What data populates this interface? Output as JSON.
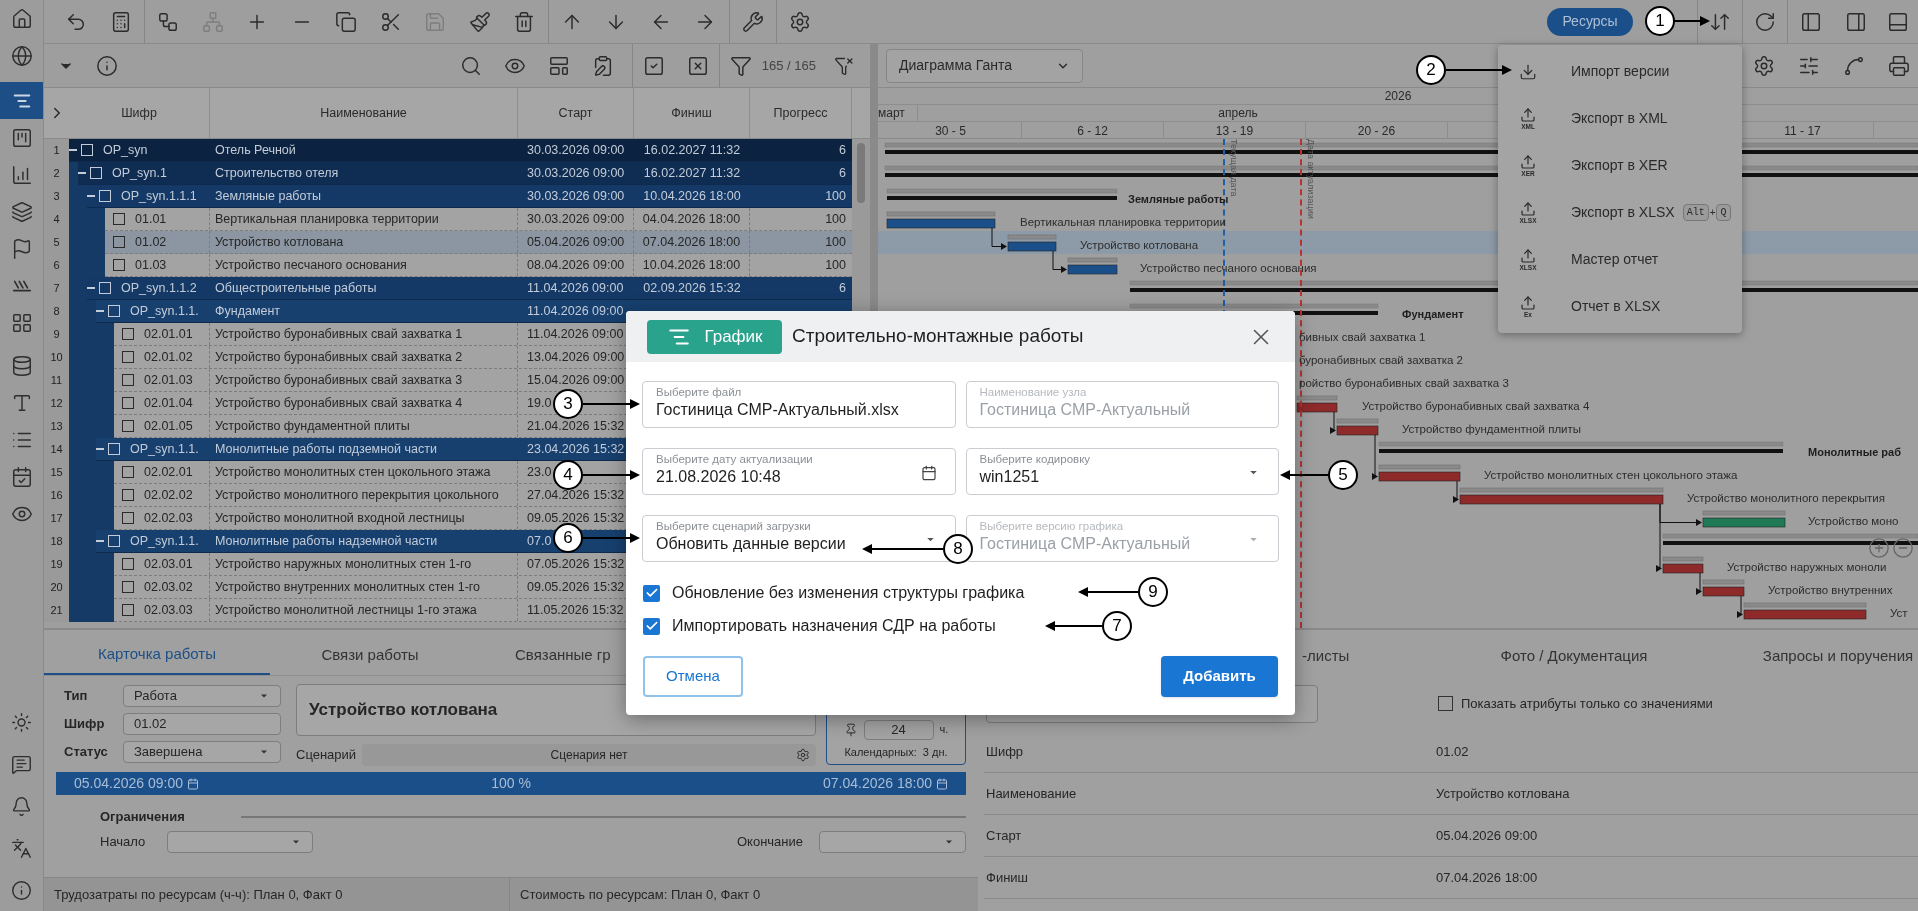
{
  "sidebar": {
    "items": [
      {
        "selected": false
      },
      {
        "selected": false
      },
      {
        "selected": true
      },
      {
        "selected": false
      },
      {
        "selected": false
      },
      {
        "selected": false
      },
      {
        "selected": false
      },
      {
        "selected": false
      },
      {
        "selected": false
      },
      {
        "selected": false
      },
      {
        "selected": false
      },
      {
        "selected": false
      },
      {
        "selected": false
      },
      {
        "selected": false
      }
    ]
  },
  "toolbar": {
    "tools": [
      {
        "disabled": false
      },
      {
        "disabled": false
      },
      {
        "disabled": false
      },
      {
        "disabled": true
      },
      {
        "disabled": false
      },
      {
        "disabled": false
      },
      {
        "disabled": false
      },
      {
        "disabled": false
      },
      {
        "disabled": true
      },
      {
        "disabled": false
      },
      {
        "disabled": false
      },
      {
        "disabled": false
      },
      {
        "disabled": false
      },
      {
        "disabled": false
      },
      {
        "disabled": false
      },
      {
        "disabled": false
      },
      {
        "disabled": false
      }
    ],
    "resources_button": "Ресурсы"
  },
  "filter_count": "165 / 165",
  "table": {
    "columns": [
      "Шифр",
      "Наименование",
      "Старт",
      "Финиш",
      "Прогресс"
    ],
    "rows": [
      {
        "num": "1",
        "code": "OP_syn",
        "name": "Отель Речной",
        "start": "30.03.2026 09:00",
        "finish": "16.02.2027 11:32",
        "progress": "6",
        "expanded": true,
        "checked": false,
        "selected": false,
        "children": [
          {
            "num": "2",
            "code": "OP_syn.1",
            "name": "Строительство отеля",
            "start": "30.03.2026 09:00",
            "finish": "16.02.2027 11:32",
            "progress": "6",
            "expanded": true,
            "checked": false,
            "selected": false,
            "children": [
              {
                "num": "3",
                "code": "OP_syn.1.1.1",
                "name": "Земляные работы",
                "start": "30.03.2026 09:00",
                "finish": "10.04.2026 18:00",
                "progress": "100",
                "expanded": true,
                "checked": false,
                "selected": false,
                "children": [
                  {
                    "num": "4",
                    "code": "01.01",
                    "name": "Вертикальная планировка территории",
                    "start": "30.03.2026 09:00",
                    "finish": "04.04.2026 18:00",
                    "progress": "100",
                    "checked": false,
                    "selected": false
                  },
                  {
                    "num": "5",
                    "code": "01.02",
                    "name": "Устройство котлована",
                    "start": "05.04.2026 09:00",
                    "finish": "07.04.2026 18:00",
                    "progress": "100",
                    "checked": false,
                    "selected": true
                  },
                  {
                    "num": "6",
                    "code": "01.03",
                    "name": "Устройство песчаного основания",
                    "start": "08.04.2026 09:00",
                    "finish": "10.04.2026 18:00",
                    "progress": "100",
                    "checked": false,
                    "selected": false
                  }
                ]
              },
              {
                "num": "7",
                "code": "OP_syn.1.1.2",
                "name": "Общестроительные работы",
                "start": "11.04.2026 09:00",
                "finish": "02.09.2026 15:32",
                "progress": "6",
                "expanded": true,
                "checked": false,
                "selected": false,
                "children": [
                  {
                    "num": "8",
                    "code": "OP_syn.1.1.",
                    "name": "Фундамент",
                    "start": "11.04.2026 09:00",
                    "expanded": true,
                    "checked": false,
                    "selected": false,
                    "children": [
                      {
                        "num": "9",
                        "code": "02.01.01",
                        "name": "Устройство буронабивных свай захватка 1",
                        "start": "11.04.2026 09:00",
                        "checked": false,
                        "selected": false
                      },
                      {
                        "num": "10",
                        "code": "02.01.02",
                        "name": "Устройство буронабивных свай захватка 2",
                        "start": "13.04.2026 09:00",
                        "checked": false,
                        "selected": false
                      },
                      {
                        "num": "11",
                        "code": "02.01.03",
                        "name": "Устройство буронабивных свай захватка 3",
                        "start": "15.04.2026 09:00",
                        "checked": false,
                        "selected": false
                      },
                      {
                        "num": "12",
                        "code": "02.01.04",
                        "name": "Устройство буронабивных свай захватка 4",
                        "start": "19.0",
                        "checked": false,
                        "selected": false
                      },
                      {
                        "num": "13",
                        "code": "02.01.05",
                        "name": "Устройство фундаментной плиты",
                        "start": "21.04.2026 15:32",
                        "checked": false,
                        "selected": false
                      }
                    ]
                  },
                  {
                    "num": "14",
                    "code": "OP_syn.1.1.",
                    "name": "Монолитные работы подземной части",
                    "start": "23.04.2026 15:32",
                    "expanded": true,
                    "checked": false,
                    "selected": false,
                    "children": [
                      {
                        "num": "15",
                        "code": "02.02.01",
                        "name": "Устройство монолитных стен цокольного этажа",
                        "start": "23.0",
                        "checked": false,
                        "selected": false
                      },
                      {
                        "num": "16",
                        "code": "02.02.02",
                        "name": "Устройство монолитного перекрытия цокольного",
                        "start": "27.04.2026 15:32",
                        "checked": false,
                        "selected": false
                      },
                      {
                        "num": "17",
                        "code": "02.02.03",
                        "name": "Устройство монолитной входной лестницы",
                        "start": "09.05.2026 15:32",
                        "checked": false,
                        "selected": false
                      }
                    ]
                  },
                  {
                    "num": "18",
                    "code": "OP_syn.1.1.",
                    "name": "Монолитные работы надземной части",
                    "start": "07.0",
                    "expanded": true,
                    "checked": false,
                    "selected": false,
                    "children": [
                      {
                        "num": "19",
                        "code": "02.03.01",
                        "name": "Устройство наружных монолитных стен 1-го",
                        "start": "07.05.2026 15:32",
                        "checked": false,
                        "selected": false
                      },
                      {
                        "num": "20",
                        "code": "02.03.02",
                        "name": "Устройство внутренних монолитных стен 1-го",
                        "start": "09.05.2026 15:32",
                        "checked": false,
                        "selected": false
                      },
                      {
                        "num": "21",
                        "code": "02.03.03",
                        "name": "Устройство монолитной лестницы 1-го этажа",
                        "start": "11.05.2026 15:32",
                        "checked": false,
                        "selected": false
                      }
                    ]
                  }
                ]
              }
            ]
          }
        ]
      }
    ]
  },
  "gantt": {
    "view": "Диаграмма Ганта",
    "year": "2026",
    "months": [
      "март",
      "апрель"
    ],
    "weeks": [
      "30 - 5",
      "6 - 12",
      "13 - 19",
      "20 - 26",
      "11 - 17"
    ],
    "markers": [
      {
        "label": "Текущая дата",
        "color": "#1f5fa8"
      },
      {
        "label": "Дата актуализации",
        "color": "#b83232"
      }
    ],
    "tasks": [
      {
        "kind": "summary"
      },
      {
        "kind": "summary"
      },
      {
        "kind": "summary",
        "label": "Земляные работы"
      },
      {
        "kind": "task",
        "color": "#1b4f8a",
        "label": "Вертикальная планировка территории"
      },
      {
        "kind": "task",
        "color": "#1b4f8a",
        "label": "Устройство котлована"
      },
      {
        "kind": "task",
        "color": "#1b4f8a",
        "label": "Устройство песчаного основания"
      },
      {
        "kind": "summary"
      },
      {
        "kind": "summary",
        "label": "Фундамент"
      },
      {
        "kind": "task",
        "label": "бивных свай захватка 1"
      },
      {
        "kind": "task",
        "label": "буронабивных свай захватка 2"
      },
      {
        "kind": "task",
        "label": "ройство буронабивных свай захватка 3"
      },
      {
        "kind": "task",
        "color": "#8f2a2a",
        "label": "Устройство буронабивных свай захватка 4"
      },
      {
        "kind": "task",
        "color": "#8f2a2a",
        "label": "Устройство фундаментной плиты"
      },
      {
        "kind": "summary",
        "label": "Монолитные раб"
      },
      {
        "kind": "task",
        "color": "#8f2a2a",
        "label": "Устройство монолитных стен цокольного этажа"
      },
      {
        "kind": "task",
        "color": "#8f2a2a",
        "label": "Устройство монолитного перекрытия"
      },
      {
        "kind": "task",
        "color": "#1f7a55",
        "label": "Устройство моно"
      },
      {
        "kind": "summary"
      },
      {
        "kind": "task",
        "color": "#8f2a2a",
        "label": "Устройство наружных моноли"
      },
      {
        "kind": "task",
        "color": "#8f2a2a",
        "label": "Устройство внутренних"
      },
      {
        "kind": "task",
        "color": "#8f2a2a",
        "label": "Уст"
      }
    ]
  },
  "menu": {
    "items": [
      {
        "label": "Импорт версии"
      },
      {
        "label": "Экспорт в XML",
        "badge": "XML"
      },
      {
        "label": "Экспорт в XER",
        "badge": "XER"
      },
      {
        "label": "Экспорт в XLSX",
        "badge": "XLSX",
        "shortcut": [
          "Alt",
          "+",
          "Q"
        ]
      },
      {
        "label": "Мастер отчет",
        "badge": "XLSX"
      },
      {
        "label": "Отчет в XLSX",
        "badge": "Ex"
      }
    ]
  },
  "card": {
    "tabs": [
      {
        "label": "Карточка работы",
        "selected": true
      },
      {
        "label": "Связи работы",
        "selected": false
      },
      {
        "label": "Связанные гр",
        "selected": false
      }
    ],
    "type_label": "Тип",
    "type_value": "Работа",
    "code_label": "Шифр",
    "code_value": "01.02",
    "status_label": "Статус",
    "status_value": "Завершена",
    "title": "Устройство котлована",
    "scenario_label": "Сценарий",
    "scenario_value": "Сценария нет",
    "hours": "24",
    "hours_unit": "ч.",
    "calendar_days": "Календарных:  3 дн.",
    "start": "05.04.2026 09:00",
    "progress_text": "100 %",
    "progress": {
      "level": 1
    },
    "finish": "07.04.2026 18:00",
    "constraints_title": "Ограничения",
    "begin_label": "Начало",
    "end_label": "Окончание",
    "footer": [
      "Трудозатраты по ресурсам (ч-ч): План 0, Факт 0",
      "Стоимость по ресурсам: План 0, Факт 0"
    ]
  },
  "attributes": {
    "tabs": [
      {
        "label": "-листы",
        "selected": false
      },
      {
        "label": "Фото / Документация",
        "selected": false
      },
      {
        "label": "Запросы и поручения",
        "selected": false
      }
    ],
    "only_filled": {
      "label": "Показать атрибуты только со значениями",
      "checked": false
    },
    "rows": [
      {
        "name": "Шифр",
        "value": "01.02"
      },
      {
        "name": "Наименование",
        "value": "Устройство котлована"
      },
      {
        "name": "Старт",
        "value": "05.04.2026 09:00"
      },
      {
        "name": "Финиш",
        "value": "07.04.2026 18:00"
      }
    ]
  },
  "dialog": {
    "badge": "График",
    "title": "Строительно-монтажные работы",
    "fields": [
      {
        "label": "Выберите файл",
        "value": "Гостиница СМР-Актуальный.xlsx",
        "kind": "text",
        "disabled": false
      },
      {
        "label": "Наименование узла",
        "value": "Гостиница СМР-Актуальный",
        "kind": "text",
        "disabled": true
      },
      {
        "label": "Выберите дату актуализации",
        "value": "21.08.2026 10:48",
        "kind": "date",
        "disabled": false
      },
      {
        "label": "Выберите кодировку",
        "value": "win1251",
        "kind": "select",
        "disabled": false
      },
      {
        "label": "Выберите сценарий загрузки",
        "value": "Обновить данные версии",
        "kind": "select",
        "disabled": false
      },
      {
        "label": "Выберите версию графика",
        "value": "Гостиница СМР-Актуальный",
        "kind": "select",
        "disabled": true
      }
    ],
    "checkboxes": [
      {
        "label": "Обновление без изменения структуры графика",
        "checked": true
      },
      {
        "label": "Импортировать назначения СДР на работы",
        "checked": true
      }
    ],
    "cancel": "Отмена",
    "submit": "Добавить"
  },
  "callouts": [
    {
      "number": "1"
    },
    {
      "number": "2"
    },
    {
      "number": "3"
    },
    {
      "number": "4"
    },
    {
      "number": "5"
    },
    {
      "number": "6"
    },
    {
      "number": "8"
    },
    {
      "number": "9"
    },
    {
      "number": "7"
    }
  ]
}
